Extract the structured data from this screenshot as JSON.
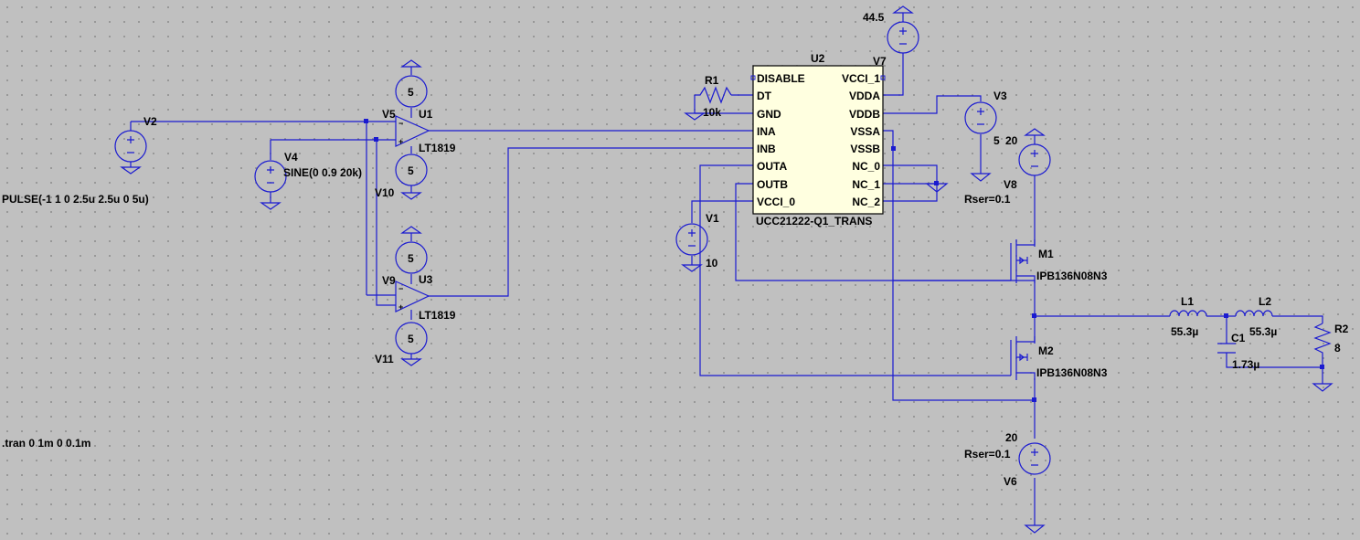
{
  "colors": {
    "background": "#c0c0c0",
    "wire": "#1b1bd0",
    "text": "#000000",
    "chip_fill": "#ffffe0"
  },
  "components": {
    "v2": {
      "ref": "V2",
      "value": "PULSE(-1 1 0 2.5u 2.5u 0 5u)"
    },
    "v4": {
      "ref": "V4",
      "value": "SINE(0 0.9 20k)"
    },
    "v5": {
      "ref": "V5",
      "value": "5"
    },
    "v10": {
      "ref": "V10",
      "value": "5"
    },
    "v9": {
      "ref": "V9",
      "value": "5"
    },
    "v11": {
      "ref": "V11",
      "value": "5"
    },
    "u1": {
      "ref": "U1",
      "value": "LT1819"
    },
    "u3": {
      "ref": "U3",
      "value": "LT1819"
    },
    "r1": {
      "ref": "R1",
      "value": "10k"
    },
    "u2": {
      "ref": "U2",
      "value": "UCC21222-Q1_TRANS",
      "left_pins": [
        "DISABLE",
        "DT",
        "GND",
        "INA",
        "INB",
        "OUTA",
        "OUTB",
        "VCCI_0"
      ],
      "right_pins": [
        "VCCI_1",
        "VDDA",
        "VDDB",
        "VSSA",
        "VSSB",
        "NC_0",
        "NC_1",
        "NC_2"
      ]
    },
    "v7": {
      "ref": "V7",
      "value": "44.5"
    },
    "v3": {
      "ref": "V3",
      "value": "5"
    },
    "v1": {
      "ref": "V1",
      "value": "10"
    },
    "v8": {
      "ref": "V8",
      "value": "20",
      "rser": "Rser=0.1"
    },
    "v6": {
      "ref": "V6",
      "value": "20",
      "rser": "Rser=0.1"
    },
    "m1": {
      "ref": "M1",
      "value": "IPB136N08N3"
    },
    "m2": {
      "ref": "M2",
      "value": "IPB136N08N3"
    },
    "l1": {
      "ref": "L1",
      "value": "55.3µ"
    },
    "l2": {
      "ref": "L2",
      "value": "55.3µ"
    },
    "c1": {
      "ref": "C1",
      "value": "1.73µ"
    },
    "r2": {
      "ref": "R2",
      "value": "8"
    }
  },
  "directives": {
    "tran": ".tran 0 1m 0 0.1m"
  }
}
